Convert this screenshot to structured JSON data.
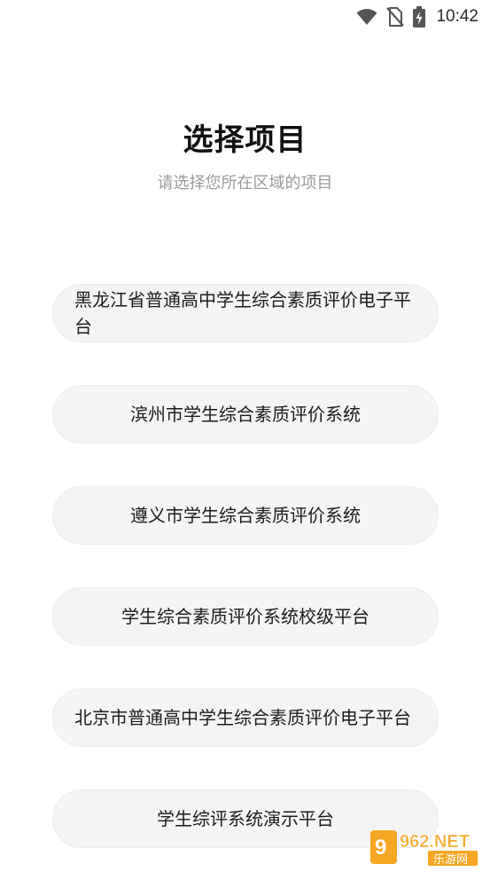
{
  "status_bar": {
    "time": "10:42",
    "icons": [
      "wifi-icon",
      "no-sim-icon",
      "battery-charging-icon"
    ]
  },
  "header": {
    "title": "选择项目",
    "subtitle": "请选择您所在区域的项目"
  },
  "projects": [
    {
      "label": "黑龙江省普通高中学生综合素质评价电子平台"
    },
    {
      "label": "滨州市学生综合素质评价系统"
    },
    {
      "label": "遵义市学生综合素质评价系统"
    },
    {
      "label": "学生综合素质评价系统校级平台"
    },
    {
      "label": "北京市普通高中学生综合素质评价电子平台"
    },
    {
      "label": "学生综评系统演示平台"
    }
  ],
  "watermark": {
    "brand": "962.NET",
    "sub": "乐游网"
  },
  "colors": {
    "title": "#111111",
    "subtitle": "#9a9a9a",
    "item_bg": "#f4f4f4",
    "watermark_orange": "#f5a623"
  }
}
